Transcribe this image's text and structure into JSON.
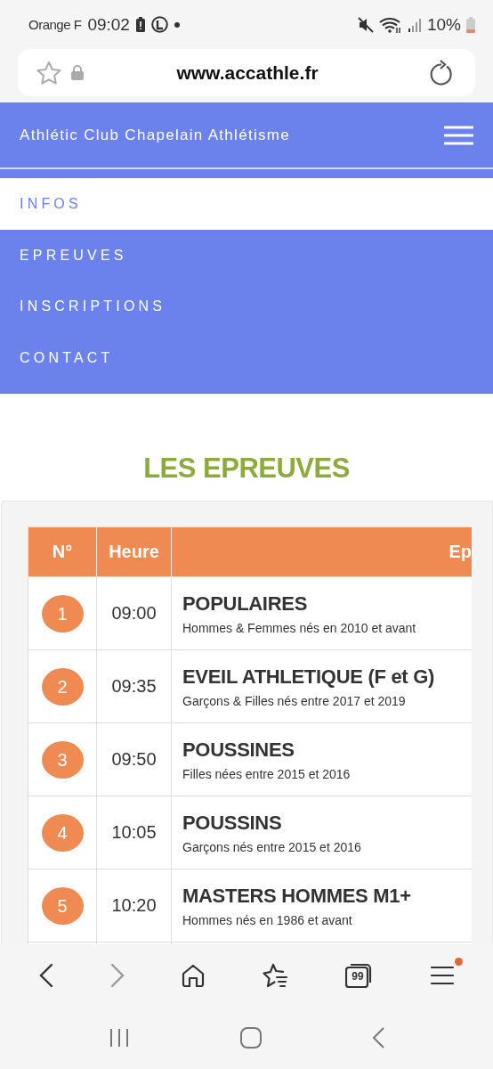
{
  "status_bar": {
    "carrier": "Orange F",
    "time": "09:02",
    "battery": "10%"
  },
  "address_bar": {
    "url": "www.accathle.fr"
  },
  "site_header": {
    "title": "Athlétic Club Chapelain Athlétisme"
  },
  "nav": [
    {
      "label": "INFOS",
      "selected": true
    },
    {
      "label": "EPREUVES",
      "selected": false
    },
    {
      "label": "INSCRIPTIONS",
      "selected": false
    },
    {
      "label": "CONTACT",
      "selected": false
    }
  ],
  "heading": "LES EPREUVES",
  "table": {
    "columns": [
      "N°",
      "Heure",
      "Ep"
    ],
    "rows": [
      {
        "number": "1",
        "time": "09:00",
        "title": "POPULAIRES",
        "detail": "Hommes & Femmes nés en 2010 et avant"
      },
      {
        "number": "2",
        "time": "09:35",
        "title": "EVEIL ATHLETIQUE (F et G)",
        "detail": "Garçons & Filles nés entre 2017 et 2019"
      },
      {
        "number": "3",
        "time": "09:50",
        "title": "POUSSINES",
        "detail": "Filles nées entre 2015 et 2016"
      },
      {
        "number": "4",
        "time": "10:05",
        "title": "POUSSINS",
        "detail": "Garçons nés entre 2015 et 2016"
      },
      {
        "number": "5",
        "time": "10:20",
        "title": "MASTERS HOMMES M1+",
        "detail": "Hommes nés en 1986 et avant"
      }
    ]
  },
  "browser_toolbar": {
    "tab_count": "99",
    "menu_badge": true
  }
}
